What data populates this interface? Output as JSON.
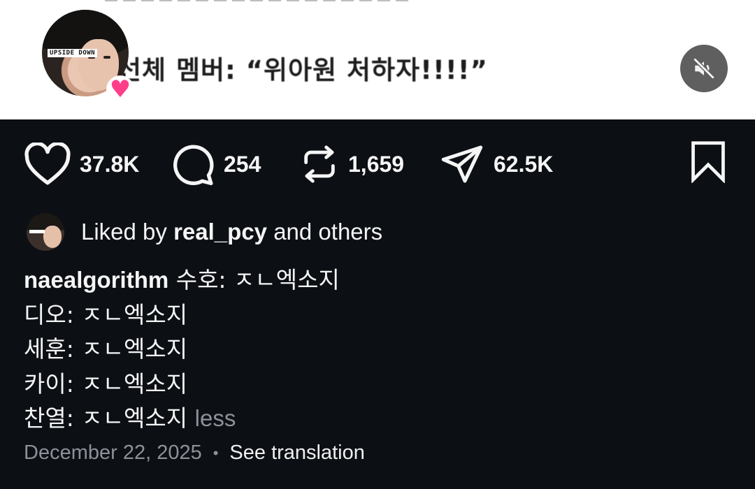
{
  "media": {
    "caption_text": "선체 멤버: “위아원 처하자!!!!”",
    "avatar_tag": "UPSIDE DOWN",
    "mute_icon": "volume-muted-icon"
  },
  "actions": {
    "like": {
      "icon": "heart-icon",
      "count": "37.8K"
    },
    "comment": {
      "icon": "comment-bubble-icon",
      "count": "254"
    },
    "repost": {
      "icon": "repost-icon",
      "count": "1,659"
    },
    "share": {
      "icon": "paper-plane-icon",
      "count": "62.5K"
    },
    "save": {
      "icon": "bookmark-icon"
    }
  },
  "liked_by": {
    "prefix": "Liked by ",
    "user": "real_pcy",
    "suffix": " and others"
  },
  "caption": {
    "username": "naealgorithm",
    "lines": [
      "수호: ㅈㄴ엑소지",
      "디오: ㅈㄴ엑소지",
      "세훈: ㅈㄴ엑소지",
      "카이: ㅈㄴ엑소지",
      "찬열: ㅈㄴ엑소지"
    ],
    "less_label": "less"
  },
  "meta": {
    "date": "December 22, 2025",
    "separator": "•",
    "translate_label": "See translation"
  },
  "colors": {
    "background": "#0c0f14",
    "text": "#f5f5f5",
    "muted": "#8e9199",
    "heart_badge": "#ff3e8a"
  }
}
